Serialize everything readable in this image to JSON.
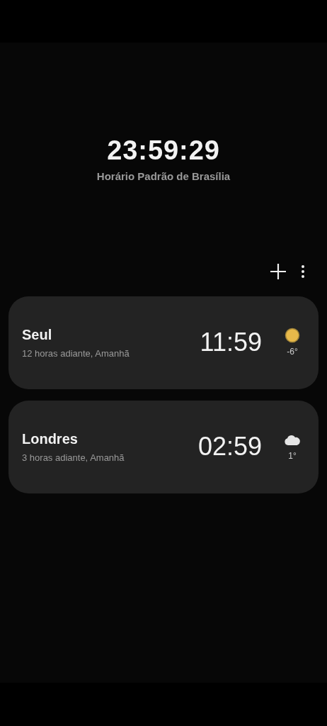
{
  "clock": {
    "time": "23:59:29",
    "zone": "Horário Padrão de Brasília"
  },
  "cities": [
    {
      "name": "Seul",
      "offset": "12 horas adiante, Amanhã",
      "time": "11:59",
      "weather": {
        "kind": "sun",
        "temp": "-6°"
      }
    },
    {
      "name": "Londres",
      "offset": "3 horas adiante, Amanhã",
      "time": "02:59",
      "weather": {
        "kind": "cloud",
        "temp": "1°"
      }
    }
  ]
}
